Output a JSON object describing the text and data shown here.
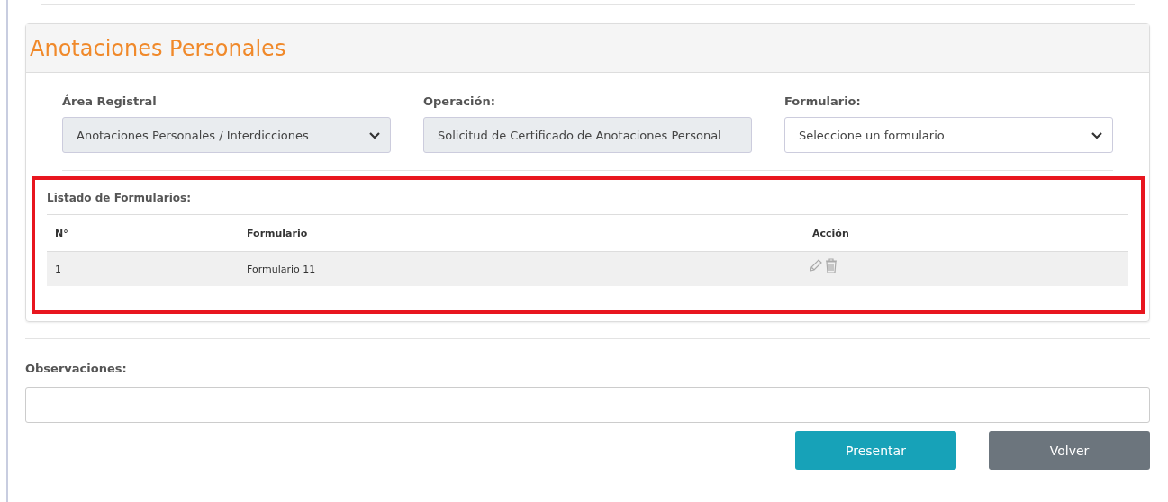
{
  "panel": {
    "title": "Anotaciones Personales",
    "fields": [
      {
        "label": "Área Registral",
        "kind": "select",
        "value": "Anotaciones Personales / Interdicciones",
        "disabled": true
      },
      {
        "label": "Operación:",
        "kind": "text",
        "value": "Solicitud de Certificado de Anotaciones Personal",
        "disabled": true
      },
      {
        "label": "Formulario:",
        "kind": "select",
        "value": "Seleccione un formulario",
        "disabled": false
      }
    ],
    "forms_list": {
      "title": "Listado de Formularios:",
      "highlighted": true,
      "columns": [
        "N°",
        "Formulario",
        "Acción"
      ],
      "rows": [
        {
          "number": "1",
          "form": "Formulario 11"
        }
      ]
    }
  },
  "observations": {
    "label": "Observaciones:"
  },
  "buttons": [
    {
      "label": "Presentar",
      "kind": "primary"
    },
    {
      "label": "Volver",
      "kind": "secondary"
    }
  ]
}
